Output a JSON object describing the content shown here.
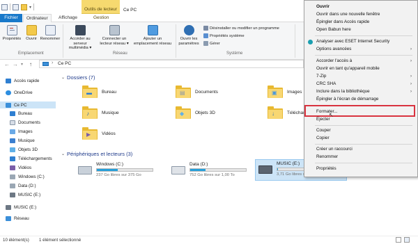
{
  "titlebar": {
    "context_group": "Outils de lecteur",
    "window_title": "Ce PC"
  },
  "ribbon_tabs": {
    "fichier": "Fichier",
    "ordinateur": "Ordinateur",
    "affichage": "Affichage",
    "gestion": "Gestion"
  },
  "ribbon": {
    "proprietes": "Propriétés",
    "ouvrir": "Ouvrir",
    "renommer": "Renommer",
    "group_emplacement": "Emplacement",
    "acceder_l1": "Accéder au serveur",
    "acceder_l2": "multimédia ▾",
    "connecter_l1": "Connecter un",
    "connecter_l2": "lecteur réseau ▾",
    "ajouter_l1": "Ajouter un",
    "ajouter_l2": "emplacement réseau",
    "group_reseau": "Réseau",
    "ouvrir_param_l1": "Ouvrir les",
    "ouvrir_param_l2": "paramètres",
    "desinstaller": "Désinstaller ou modifier un programme",
    "proprietes_systeme": "Propriétés système",
    "gerer": "Gérer",
    "group_systeme": "Système"
  },
  "address": {
    "path": "Ce PC"
  },
  "navpane": {
    "acces_rapide": "Accès rapide",
    "onedrive": "OneDrive",
    "ce_pc": "Ce PC",
    "bureau": "Bureau",
    "documents": "Documents",
    "images": "Images",
    "musique": "Musique",
    "objets3d": "Objets 3D",
    "telechargements": "Téléchargements",
    "videos": "Vidéos",
    "windows_c": "Windows (C:)",
    "data_d": "Data (D:)",
    "music_e_sub": "MUSIC (E:)",
    "music_e": "MUSIC (E:)",
    "reseau": "Réseau"
  },
  "content": {
    "dossiers_header": "Dossiers (7)",
    "folders": [
      "Bureau",
      "Documents",
      "Images",
      "Musique",
      "Objets 3D",
      "Téléchargements",
      "Vidéos"
    ],
    "drives_header": "Périphériques et lecteurs (3)",
    "drives": [
      {
        "name": "Windows (C:)",
        "free": "237 Go libres sur 375 Go",
        "used_fraction": 0.37
      },
      {
        "name": "Data (D:)",
        "free": "752 Go libres sur 1,00 To",
        "used_fraction": 0.27
      },
      {
        "name": "MUSIC (E:)",
        "free": "3,71 Go libres sur 3,72 Go",
        "used_fraction": 0.01
      }
    ]
  },
  "status": {
    "count": "10 élément(s)",
    "selected": "1 élément sélectionné"
  },
  "context_menu": {
    "items": [
      "Ouvrir",
      "Ouvrir dans une nouvelle fenêtre",
      "Épingler dans Accès rapide",
      "Open Babun here",
      "Analyser avec ESET Internet Security",
      "Options avancées",
      "Accorder l'accès à",
      "Ouvrir en tant qu'appareil mobile",
      "7-Zip",
      "CRC SHA",
      "Inclure dans la bibliothèque",
      "Épingler à l'écran de démarrage",
      "Formater...",
      "Éjecter",
      "Couper",
      "Copier",
      "Créer un raccourci",
      "Renommer",
      "Propriétés"
    ]
  },
  "colors": {
    "accent": "#1979ca",
    "drive_bar": "#26a0da",
    "context_tab": "#f6d96f",
    "highlight_box": "#d9333f",
    "selected_nav": "#cce4f7"
  }
}
